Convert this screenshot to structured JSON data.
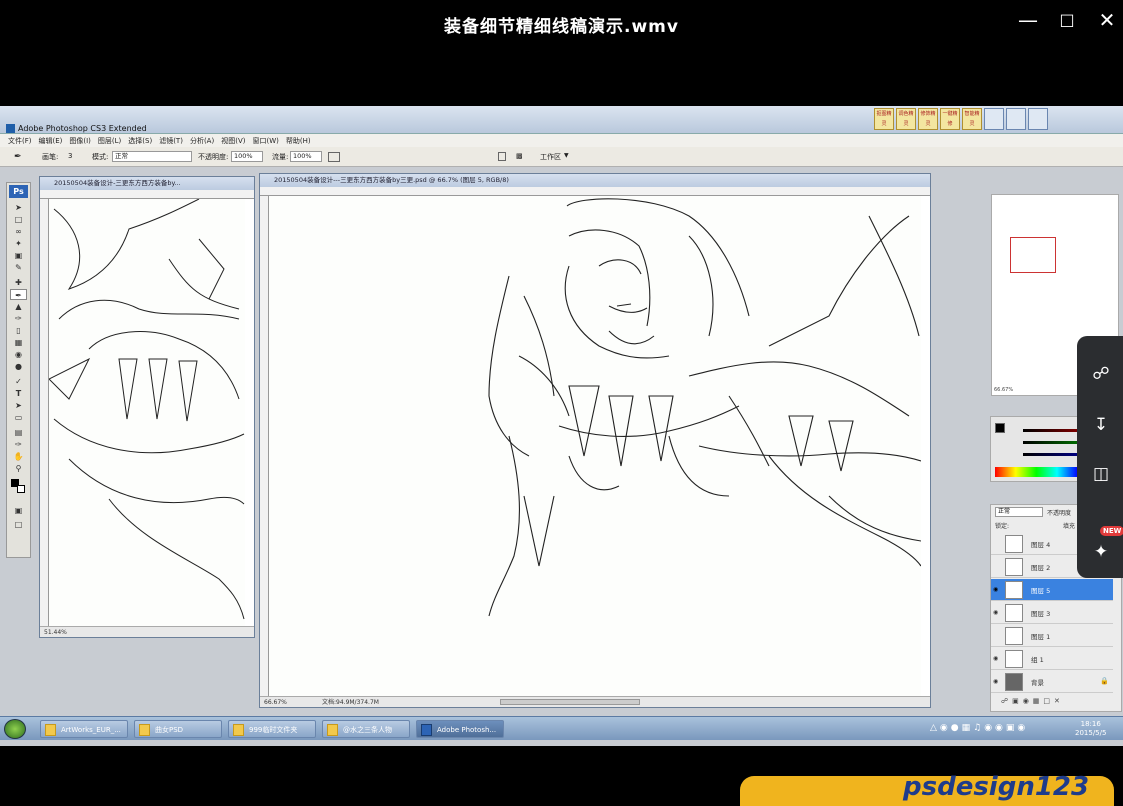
{
  "player": {
    "title": "装备细节精细线稿演示.wmv",
    "minimize_icon": "minimize-icon",
    "maximize_icon": "maximize-icon",
    "close_icon": "close-icon"
  },
  "photoshop": {
    "app_title": "Adobe Photoshop CS3 Extended",
    "menu": [
      "文件(F)",
      "编辑(E)",
      "图像(I)",
      "图层(L)",
      "选择(S)",
      "滤镜(T)",
      "分析(A)",
      "视图(V)",
      "窗口(W)",
      "帮助(H)"
    ],
    "options": {
      "brush_label": "画笔:",
      "brush_size": "3",
      "mode_label": "模式:",
      "mode_value": "正常",
      "opacity_label": "不透明度:",
      "opacity_value": "100%",
      "flow_label": "流量:",
      "flow_value": "100%",
      "workspace_label": "工作区"
    },
    "top_right_buttons": [
      "抠图精灵",
      "调色精灵",
      "修饰精灵",
      "一键精修",
      "智能精灵"
    ],
    "document_left": {
      "title": "20150504装备设计-三更东方西方装备by...",
      "zoom": "51.44%"
    },
    "document_main": {
      "title": "20150504装备设计---三更东方西方装备by三更.psd @ 66.7% (图层 5, RGB/8)",
      "zoom": "66.67%",
      "doc_size": "文档:94.9M/374.7M"
    },
    "navigator_zoom": "66.67%",
    "layers_panel": {
      "blend_mode": "正常",
      "opacity_label": "不透明度",
      "lock_label": "锁定:",
      "fill_label": "填充",
      "rows": [
        {
          "name": "图层 4",
          "visible": false,
          "selected": false
        },
        {
          "name": "图层 2",
          "visible": false,
          "selected": false
        },
        {
          "name": "图层 5",
          "visible": true,
          "selected": true
        },
        {
          "name": "图层 3",
          "visible": true,
          "selected": false
        },
        {
          "name": "图层 1",
          "visible": false,
          "selected": false
        },
        {
          "name": "组 1",
          "visible": true,
          "selected": false
        },
        {
          "name": "背景",
          "visible": true,
          "selected": false
        }
      ]
    }
  },
  "taskbar": {
    "items": [
      {
        "label": "ArtWorks_EUR_...",
        "icon": "folder-icon"
      },
      {
        "label": "曲女PSD",
        "icon": "folder-icon"
      },
      {
        "label": "999临时文件夹",
        "icon": "folder-icon"
      },
      {
        "label": "@水之三条人物",
        "icon": "folder-icon"
      },
      {
        "label": "Adobe Photosh...",
        "icon": "photoshop-icon"
      }
    ],
    "time": "18:16",
    "date": "2015/5/5"
  },
  "side_toolbar": {
    "buttons": [
      "share-icon",
      "download-icon",
      "delete-icon",
      "pin-icon"
    ],
    "badge": "NEW"
  },
  "watermark": {
    "text": "psdesign123"
  },
  "colors": {
    "player_bg": "#000000",
    "ps_chrome": "#c8ccd2",
    "selected_layer": "#3a82e0",
    "sidebar_bg": "#2b2d30",
    "watermark_bg": "#f0b41e"
  }
}
